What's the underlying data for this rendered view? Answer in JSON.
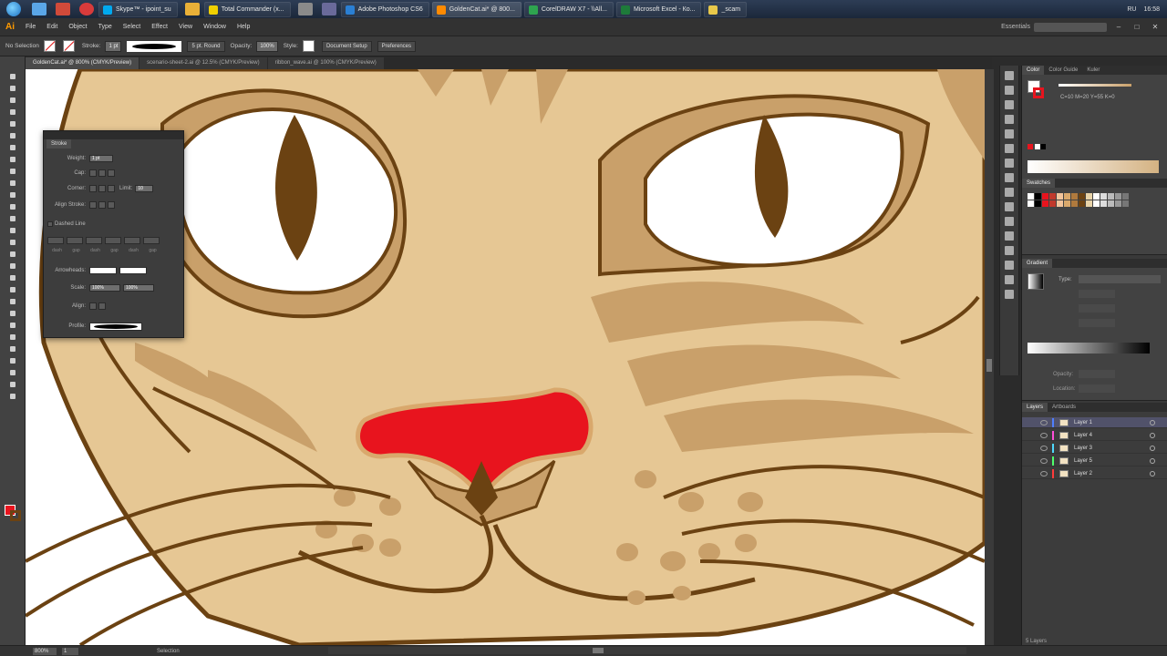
{
  "taskbar": {
    "tasks": [
      {
        "label": "Skype™ - ipoint_su",
        "color": "#00a9f0"
      },
      {
        "label": "Total Commander (x...",
        "color": "#f0d000"
      },
      {
        "label": "Adobe Photoshop CS6",
        "color": "#2a7fd4"
      },
      {
        "label": "GoldenCat.ai* @ 800...",
        "color": "#ff8a00"
      },
      {
        "label": "CorelDRAW X7 - \\\\All...",
        "color": "#2ea44f"
      },
      {
        "label": "Microsoft Excel - Ко...",
        "color": "#1e7b3a"
      },
      {
        "label": "_scam",
        "color": "#e8c84a"
      }
    ],
    "lang": "RU",
    "time": "16:58"
  },
  "app": {
    "logo": "Ai",
    "menu": [
      "File",
      "Edit",
      "Object",
      "Type",
      "Select",
      "Effect",
      "View",
      "Window",
      "Help"
    ],
    "workspace": "Essentials"
  },
  "control_bar": {
    "selection_label": "No Selection",
    "stroke_label": "Stroke:",
    "stroke_weight": "1 pt",
    "brush_label": "5 pt. Round",
    "opacity_label": "Opacity:",
    "opacity_value": "100%",
    "style_label": "Style:",
    "doc_setup": "Document Setup",
    "preferences": "Preferences"
  },
  "doc_tabs": [
    {
      "label": "GoldenCat.ai* @ 800% (CMYK/Preview)",
      "active": true
    },
    {
      "label": "scenario-sheet-2.ai @ 12.5% (CMYK/Preview)",
      "active": false
    },
    {
      "label": "ribbon_wave.ai @ 100% (CMYK/Preview)",
      "active": false
    }
  ],
  "stroke_panel": {
    "tab": "Stroke",
    "weight_label": "Weight:",
    "weight_value": "1 pt",
    "cap_label": "Cap:",
    "corner_label": "Corner:",
    "limit_label": "Limit:",
    "limit_value": "10",
    "align_label": "Align Stroke:",
    "dashed_label": "Dashed Line",
    "dash_labels": [
      "dash",
      "gap",
      "dash",
      "gap",
      "dash",
      "gap"
    ],
    "arrowheads_label": "Arrowheads:",
    "scale_label": "Scale:",
    "scale_values": [
      "100%",
      "100%"
    ],
    "align_arrows_label": "Align:",
    "profile_label": "Profile:"
  },
  "right_panels": {
    "color_tabs": [
      "Color",
      "Color Guide",
      "Kuler"
    ],
    "color_value": "C=10 M=20 Y=55 K=0",
    "swatches_tab": "Swatches",
    "swatch_colors": [
      "#ffffff",
      "#000000",
      "#e8141e",
      "#c0392b",
      "#f2c49b",
      "#d9a86c",
      "#b07a3d",
      "#6b4212",
      "#e8d3a8",
      "#ffffff",
      "#dddddd",
      "#bbbbbb",
      "#999999",
      "#777777"
    ],
    "gradient_tab": "Gradient",
    "gradient_type_label": "Type:",
    "opacity_label": "Opacity:",
    "location_label": "Location:",
    "layers_tabs": [
      "Layers",
      "Artboards"
    ],
    "layers": [
      {
        "name": "Layer 1",
        "color": "#4f7fff",
        "selected": true
      },
      {
        "name": "Layer 4",
        "color": "#ff4fd8",
        "selected": false
      },
      {
        "name": "Layer 3",
        "color": "#4fd8ff",
        "selected": false
      },
      {
        "name": "Layer 5",
        "color": "#4fff6b",
        "selected": false
      },
      {
        "name": "Layer 2",
        "color": "#ff3b3b",
        "selected": false
      }
    ],
    "layers_count": "5 Layers"
  },
  "statusbar": {
    "zoom": "800%",
    "artboard": "1",
    "status_text": "Selection"
  },
  "colors": {
    "fur": "#e6c794",
    "fur_dark": "#c9a06a",
    "outline": "#6b4212",
    "nose": "#e8141e",
    "eye_white": "#ffffff"
  }
}
